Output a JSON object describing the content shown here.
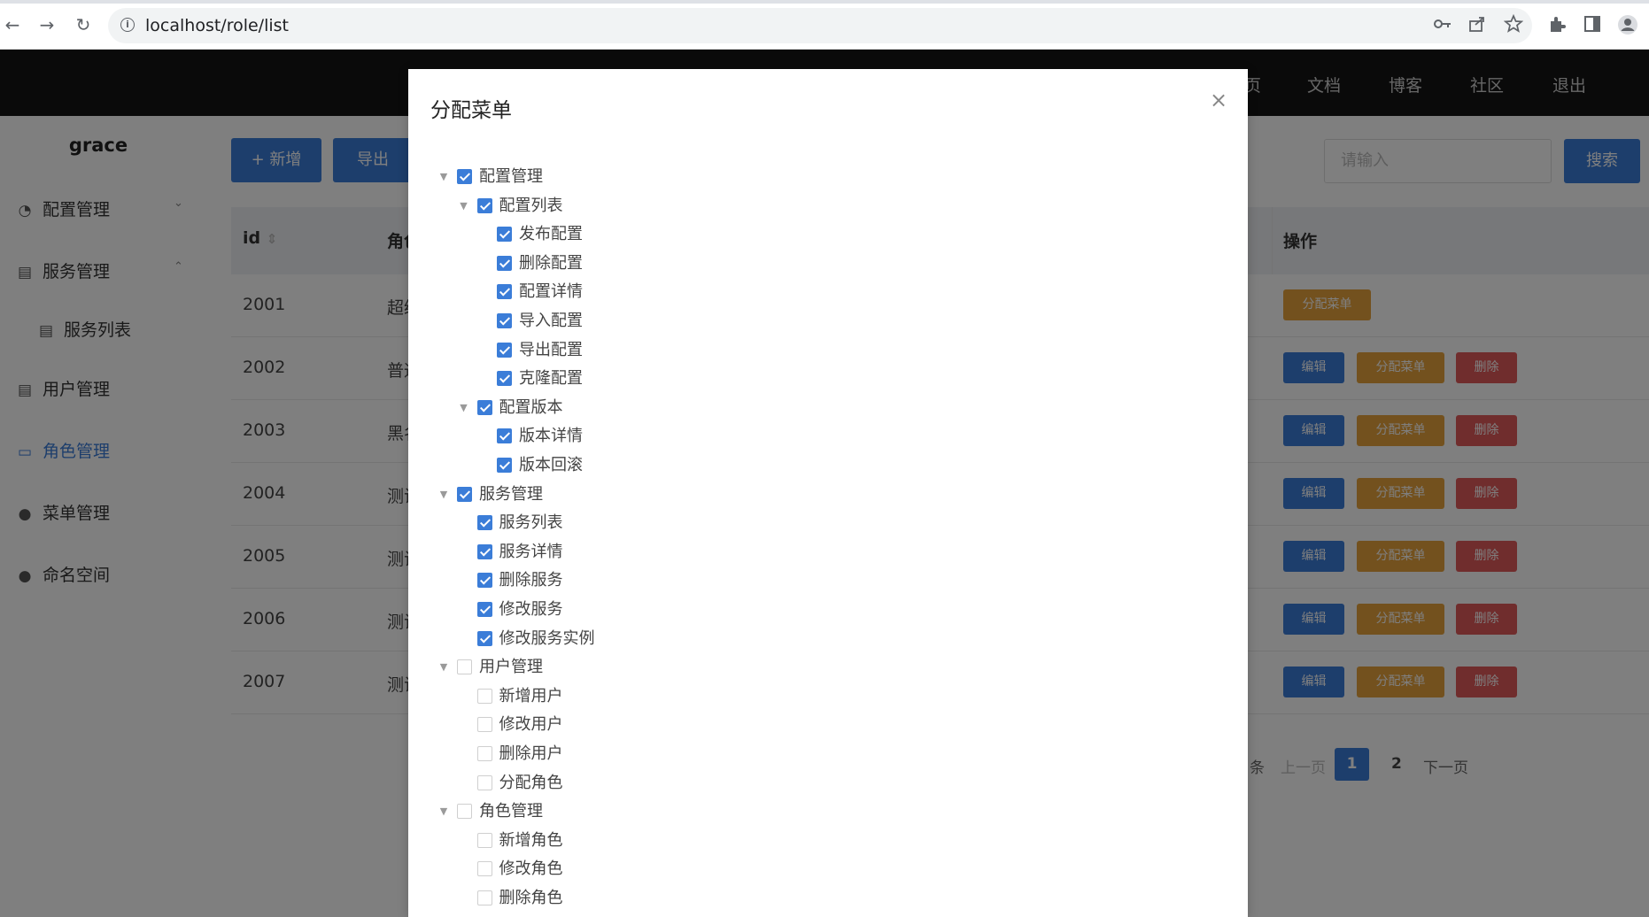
{
  "browser": {
    "url": "localhost/role/list",
    "back": "←",
    "forward": "→",
    "reload": "↻",
    "info": "i"
  },
  "header": {
    "links": [
      "页",
      "文档",
      "博客",
      "社区",
      "退出"
    ]
  },
  "sidebar": {
    "brand": "grace",
    "items": [
      {
        "label": "配置管理",
        "icon": "◔"
      },
      {
        "label": "服务管理",
        "icon": "▤"
      },
      {
        "label": "服务列表",
        "icon": "▤"
      },
      {
        "label": "用户管理",
        "icon": "▤"
      },
      {
        "label": "角色管理",
        "icon": "▭"
      },
      {
        "label": "菜单管理",
        "icon": "●"
      },
      {
        "label": "命名空间",
        "icon": "●"
      }
    ],
    "chevron_down": "⌄",
    "chevron_up": "⌃"
  },
  "toolbar": {
    "add_label": "+ 新增",
    "export_label": "导出",
    "search_placeholder": "请输入",
    "search_label": "搜索"
  },
  "table": {
    "headers": {
      "id": "id",
      "role": "角色",
      "actions": "操作"
    },
    "sort_icon": "⇕",
    "rows": [
      {
        "id": "2001",
        "role": "超级"
      },
      {
        "id": "2002",
        "role": "普通"
      },
      {
        "id": "2003",
        "role": "黑名"
      },
      {
        "id": "2004",
        "role": "测试"
      },
      {
        "id": "2005",
        "role": "测试"
      },
      {
        "id": "2006",
        "role": "测试"
      },
      {
        "id": "2007",
        "role": "测试"
      }
    ],
    "edit_label": "编辑",
    "assign_label": "分配菜单",
    "delete_label": "删除"
  },
  "pager": {
    "items_suffix": "条",
    "prev": "上一页",
    "page1": "1",
    "page2": "2",
    "next": "下一页"
  },
  "modal": {
    "title": "分配菜单",
    "close": "×",
    "tree": [
      {
        "label": "配置管理",
        "level": 0,
        "checked": true,
        "expandable": true
      },
      {
        "label": "配置列表",
        "level": 1,
        "checked": true,
        "expandable": true
      },
      {
        "label": "发布配置",
        "level": 2,
        "checked": true,
        "expandable": false
      },
      {
        "label": "删除配置",
        "level": 2,
        "checked": true,
        "expandable": false
      },
      {
        "label": "配置详情",
        "level": 2,
        "checked": true,
        "expandable": false
      },
      {
        "label": "导入配置",
        "level": 2,
        "checked": true,
        "expandable": false
      },
      {
        "label": "导出配置",
        "level": 2,
        "checked": true,
        "expandable": false
      },
      {
        "label": "克隆配置",
        "level": 2,
        "checked": true,
        "expandable": false
      },
      {
        "label": "配置版本",
        "level": 1,
        "checked": true,
        "expandable": true
      },
      {
        "label": "版本详情",
        "level": 2,
        "checked": true,
        "expandable": false
      },
      {
        "label": "版本回滚",
        "level": 2,
        "checked": true,
        "expandable": false
      },
      {
        "label": "服务管理",
        "level": 0,
        "checked": true,
        "expandable": true
      },
      {
        "label": "服务列表",
        "level": 1,
        "checked": true,
        "expandable": false
      },
      {
        "label": "服务详情",
        "level": 1,
        "checked": true,
        "expandable": false
      },
      {
        "label": "删除服务",
        "level": 1,
        "checked": true,
        "expandable": false
      },
      {
        "label": "修改服务",
        "level": 1,
        "checked": true,
        "expandable": false
      },
      {
        "label": "修改服务实例",
        "level": 1,
        "checked": true,
        "expandable": false
      },
      {
        "label": "用户管理",
        "level": 0,
        "checked": false,
        "expandable": true
      },
      {
        "label": "新增用户",
        "level": 1,
        "checked": false,
        "expandable": false
      },
      {
        "label": "修改用户",
        "level": 1,
        "checked": false,
        "expandable": false
      },
      {
        "label": "删除用户",
        "level": 1,
        "checked": false,
        "expandable": false
      },
      {
        "label": "分配角色",
        "level": 1,
        "checked": false,
        "expandable": false
      },
      {
        "label": "角色管理",
        "level": 0,
        "checked": false,
        "expandable": true
      },
      {
        "label": "新增角色",
        "level": 1,
        "checked": false,
        "expandable": false
      },
      {
        "label": "修改角色",
        "level": 1,
        "checked": false,
        "expandable": false
      },
      {
        "label": "删除角色",
        "level": 1,
        "checked": false,
        "expandable": false
      }
    ],
    "expand_arrow": "▼"
  },
  "colors": {
    "primary": "#3b7dd8",
    "warning": "#e6a23c",
    "danger": "#e05a5a",
    "header_bg": "#141414"
  }
}
